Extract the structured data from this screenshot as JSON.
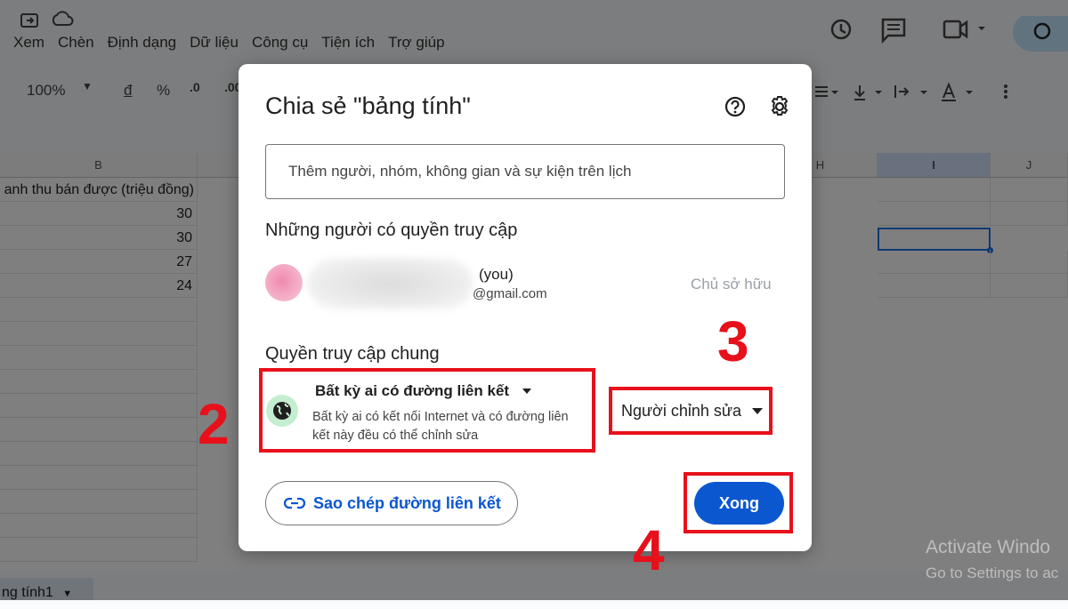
{
  "menu": {
    "items": [
      "Xem",
      "Chèn",
      "Định dạng",
      "Dữ liệu",
      "Công cụ",
      "Tiện ích",
      "Trợ giúp"
    ]
  },
  "toolbar": {
    "zoom": "100%",
    "currency": "đ",
    "percent": "%",
    "dec_decrease": ".0",
    "dec_increase": ".00"
  },
  "sheet": {
    "columns": [
      "B",
      "H",
      "I",
      "J"
    ],
    "header_cell": "anh thu bán được (triệu đồng)",
    "values": [
      "30",
      "30",
      "27",
      "24"
    ],
    "tab_name": "ng tính1"
  },
  "watermark": {
    "line1": "Activate Windo",
    "line2": "Go to Settings to ac"
  },
  "dialog": {
    "title": "Chia sẻ \"bảng tính\"",
    "input_placeholder": "Thêm người, nhóm, không gian và sự kiện trên lịch",
    "people_heading": "Những người có quyền truy cập",
    "user_you": "(you)",
    "user_email": "@gmail.com",
    "owner_label": "Chủ sở hữu",
    "general_heading": "Quyền truy cập chung",
    "access_title": "Bất kỳ ai có đường liên kết",
    "access_desc_1": "Bất kỳ ai có kết nối Internet và có đường liên",
    "access_desc_2": "kết này đều có thể chỉnh sửa",
    "role": "Người chỉnh sửa",
    "copy_link": "Sao chép đường liên kết",
    "done": "Xong"
  },
  "annotations": {
    "step2": "2",
    "step3": "3",
    "step4": "4"
  },
  "colors": {
    "accent": "#0b57d0",
    "annotation": "#e8101b",
    "globe_bg": "#c4eed0"
  }
}
